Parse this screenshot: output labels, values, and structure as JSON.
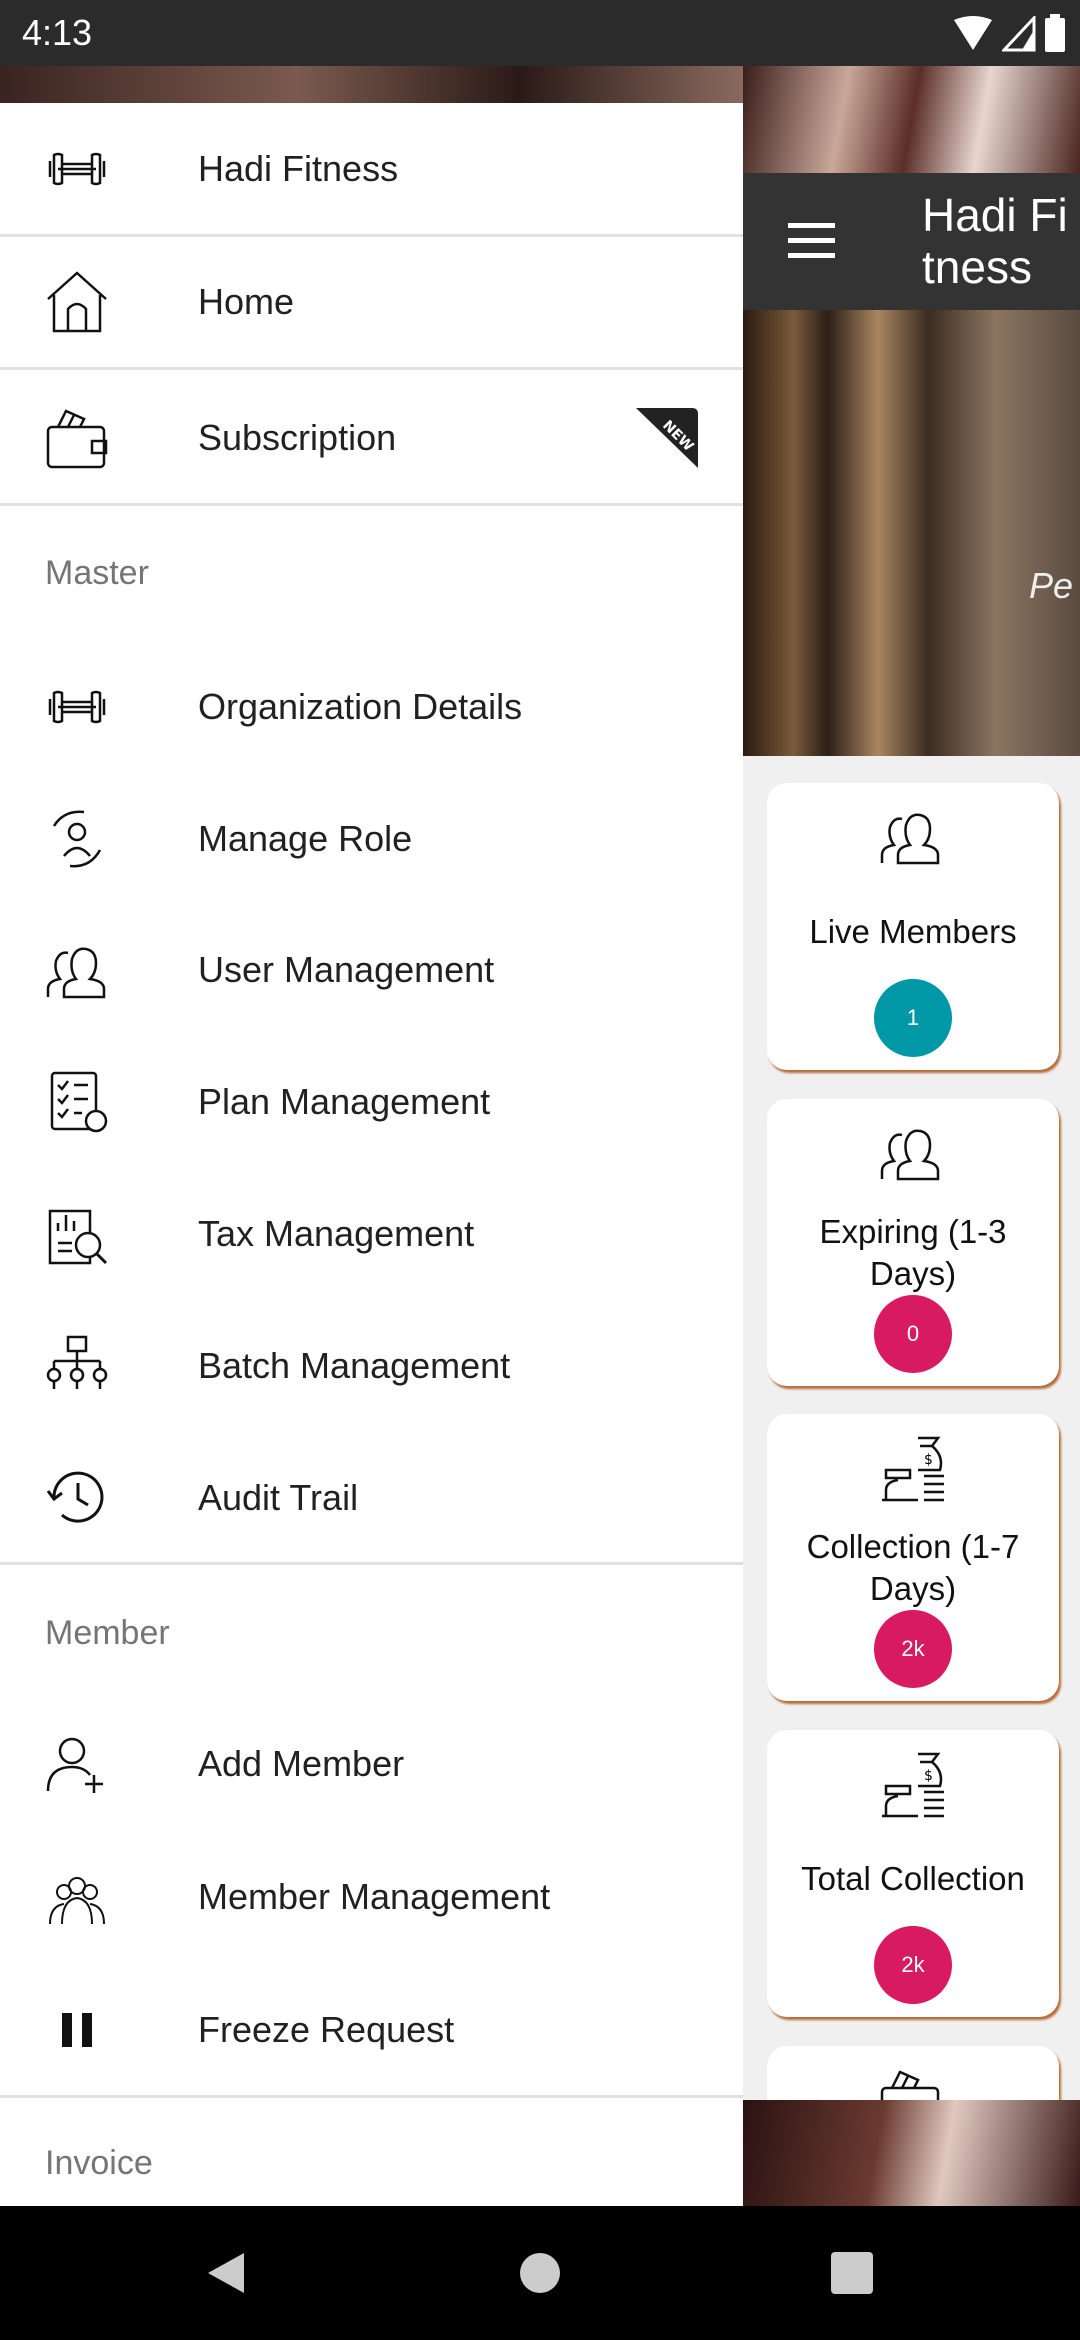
{
  "status": {
    "time": "4:13"
  },
  "toolbar": {
    "title": "Hadi Fitness",
    "menu_icon": "hamburger-icon"
  },
  "hero": {
    "text": "Pe"
  },
  "drawer": {
    "top": [
      {
        "label": "Hadi Fitness",
        "icon": "dumbbell-icon"
      },
      {
        "label": "Home",
        "icon": "home-icon"
      },
      {
        "label": "Subscription",
        "icon": "wallet-icon",
        "badge": "NEW"
      }
    ],
    "sections": [
      {
        "title": "Master",
        "items": [
          {
            "label": "Organization Details",
            "icon": "dumbbell-icon"
          },
          {
            "label": "Manage Role",
            "icon": "role-icon"
          },
          {
            "label": "User Management",
            "icon": "users-icon"
          },
          {
            "label": "Plan Management",
            "icon": "checklist-icon"
          },
          {
            "label": "Tax Management",
            "icon": "tax-icon"
          },
          {
            "label": "Batch Management",
            "icon": "hierarchy-icon"
          },
          {
            "label": "Audit Trail",
            "icon": "history-icon"
          }
        ]
      },
      {
        "title": "Member",
        "items": [
          {
            "label": "Add Member",
            "icon": "add-user-icon"
          },
          {
            "label": "Member Management",
            "icon": "group-icon"
          },
          {
            "label": "Freeze Request",
            "icon": "pause-icon"
          }
        ]
      },
      {
        "title": "Invoice",
        "items": []
      }
    ]
  },
  "cards": [
    {
      "label": "Live Members",
      "value": "1",
      "color": "#0097a7",
      "icon": "users-icon"
    },
    {
      "label": "Expiring (1-3 Days)",
      "value": "0",
      "color": "#d81b60",
      "icon": "users-icon"
    },
    {
      "label": "Collection (1-7 Days)",
      "value": "2k",
      "color": "#d81b60",
      "icon": "money-bag-icon"
    },
    {
      "label": "Total Collection",
      "value": "2k",
      "color": "#d81b60",
      "icon": "money-bag-icon"
    }
  ]
}
